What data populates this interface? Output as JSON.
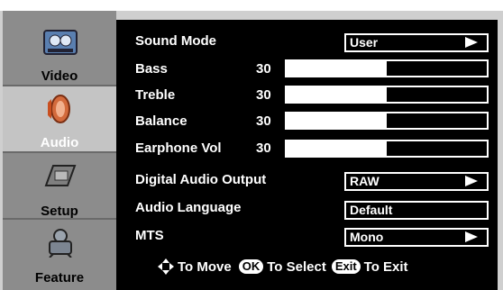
{
  "sidebar": {
    "tabs": [
      {
        "label": "Video",
        "icon": "video-film-icon"
      },
      {
        "label": "Audio",
        "icon": "speaker-icon"
      },
      {
        "label": "Setup",
        "icon": "setup-keyboard-icon"
      },
      {
        "label": "Feature",
        "icon": "feature-robot-icon"
      }
    ],
    "active": "Audio"
  },
  "menu": {
    "sound_mode": {
      "label": "Sound Mode",
      "value": "User"
    },
    "bass": {
      "label": "Bass",
      "value": "30",
      "level_pct": 50
    },
    "treble": {
      "label": "Treble",
      "value": "30",
      "level_pct": 50
    },
    "balance": {
      "label": "Balance",
      "value": "30",
      "level_pct": 50
    },
    "earphone_vol": {
      "label": "Earphone Vol",
      "value": "30",
      "level_pct": 50
    },
    "digital_audio_output": {
      "label": "Digital Audio Output",
      "value": "RAW"
    },
    "audio_language": {
      "label": "Audio Language",
      "value": "Default"
    },
    "mts": {
      "label": "MTS",
      "value": "Mono"
    }
  },
  "footer": {
    "move_text": "To Move",
    "ok_key": "OK",
    "select_text": "To Select",
    "exit_key": "Exit",
    "exit_text": "To Exit"
  },
  "colors": {
    "panel_bg": "#000000",
    "sidebar_bg": "#8c8c8c",
    "active_tab_bg": "#c4c4c4",
    "text": "#ffffff"
  }
}
